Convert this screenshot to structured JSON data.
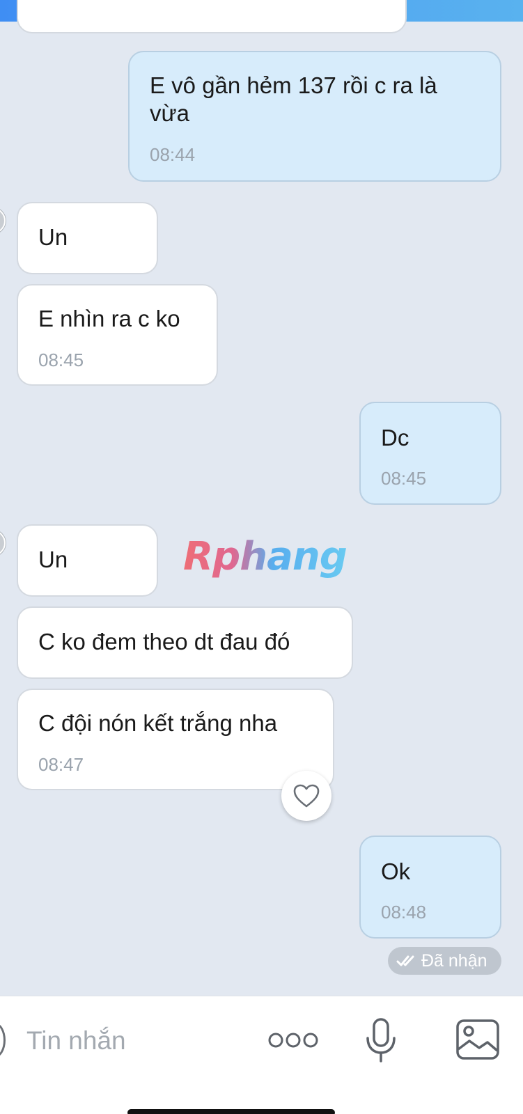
{
  "messages": [
    {
      "dir": "out",
      "text": "E vô gần hẻm 137 rồi c ra là vừa",
      "time": "08:44"
    },
    {
      "dir": "in",
      "text": "Un"
    },
    {
      "dir": "in",
      "text": "E nhìn ra c ko",
      "time": "08:45"
    },
    {
      "dir": "out",
      "text": "Dc",
      "time": "08:45"
    },
    {
      "dir": "in",
      "text": "Un"
    },
    {
      "dir": "in",
      "text": "C ko đem theo dt đau đó"
    },
    {
      "dir": "in",
      "text": "C đội nón kết trắng nha",
      "time": "08:47"
    },
    {
      "dir": "out",
      "text": "Ok",
      "time": "08:48"
    }
  ],
  "reaction_icon": "heart-outline-icon",
  "watermark": "Rphang",
  "delivery_status": "Đã nhận",
  "composer": {
    "placeholder": "Tin nhắn",
    "icons": [
      "emoji-icon",
      "more-options-icon",
      "microphone-icon",
      "image-gallery-icon"
    ]
  },
  "colors": {
    "background": "#e2e8f1",
    "incoming_bubble": "#ffffff",
    "outgoing_bubble": "#d7ecfb",
    "header_gradient": "#3f8ef3"
  }
}
